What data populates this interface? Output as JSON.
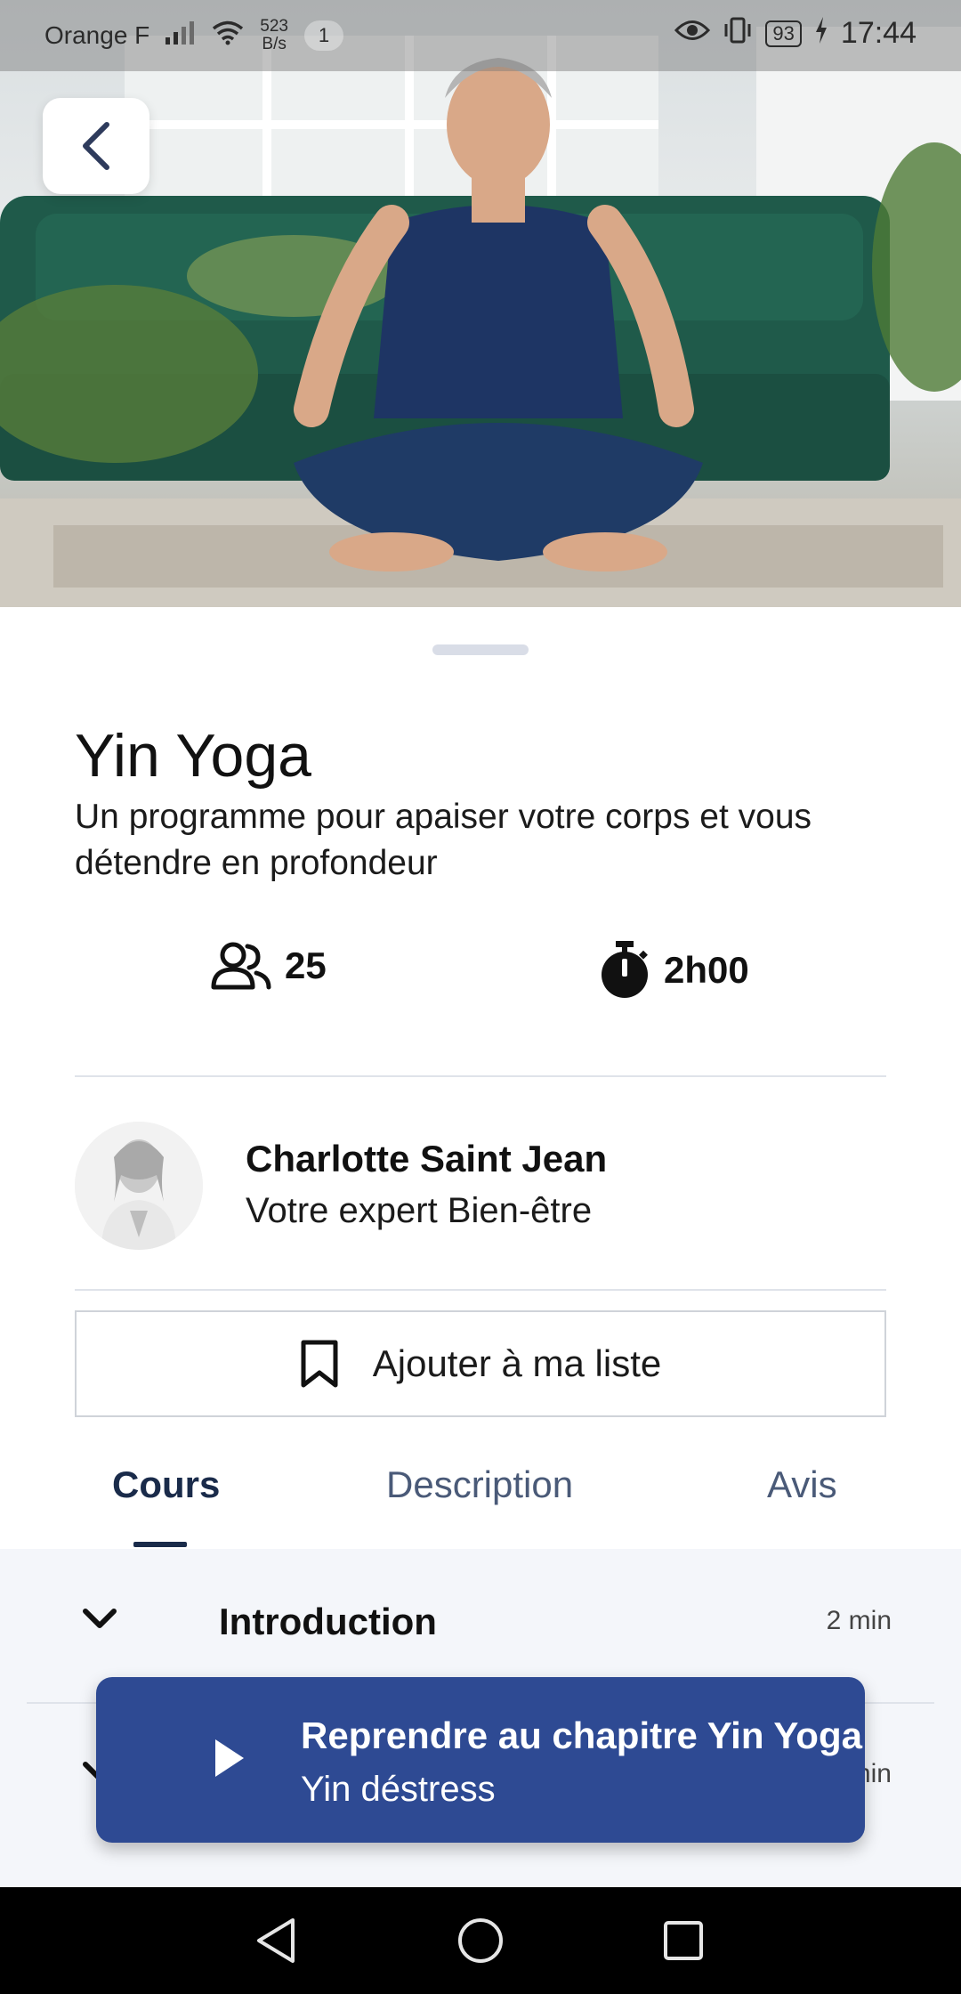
{
  "status_bar": {
    "carrier": "Orange F",
    "speed_value": "523",
    "speed_unit": "B/s",
    "notification_count": "1",
    "battery": "93",
    "time": "17:44"
  },
  "course": {
    "title": "Yin Yoga",
    "subtitle": "Un programme pour apaiser votre corps et vous détendre en profondeur",
    "participants": "25",
    "duration": "2h00"
  },
  "expert": {
    "name": "Charlotte Saint Jean",
    "role": "Votre expert Bien-être"
  },
  "actions": {
    "add_to_list": "Ajouter à ma liste"
  },
  "tabs": [
    {
      "label": "Cours",
      "active": true
    },
    {
      "label": "Description",
      "active": false
    },
    {
      "label": "Avis",
      "active": false
    }
  ],
  "chapters": [
    {
      "title": "Introduction",
      "duration": "2 min"
    },
    {
      "title": "",
      "duration": "min"
    }
  ],
  "resume": {
    "title": "Reprendre au chapitre Yin Yoga",
    "subtitle": "Yin déstress"
  },
  "colors": {
    "accent": "#2e4a93",
    "tab_active": "#1a2b4a",
    "tab_inactive": "#4a5a78",
    "list_bg": "#f4f6fa"
  },
  "icons": {
    "back": "chevron-left-icon",
    "participants": "users-icon",
    "duration": "stopwatch-icon",
    "bookmark": "bookmark-icon",
    "chapter_toggle": "chevron-down-icon",
    "play": "play-icon",
    "nav_back": "triangle-back-icon",
    "nav_home": "circle-home-icon",
    "nav_recent": "square-recent-icon"
  }
}
